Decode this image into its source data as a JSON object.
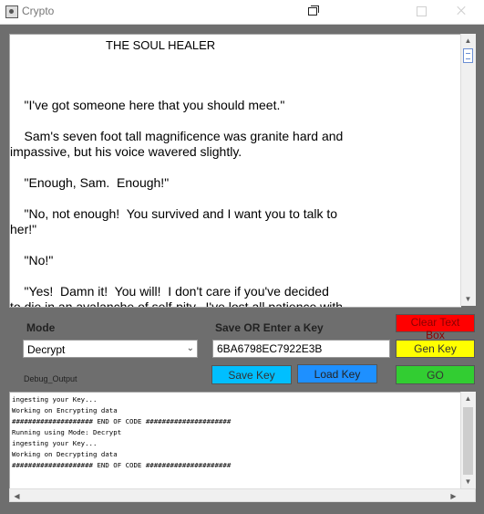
{
  "window": {
    "title": "Crypto",
    "app_icon": "app-icon",
    "controls": [
      "restore-icon",
      "maximize-icon",
      "close-icon"
    ]
  },
  "document": {
    "title": "THE SOUL HEALER",
    "paragraphs": [
      "    \"I've got someone here that you should meet.\"",
      "    Sam's seven foot tall magnificence was granite hard and",
      "impassive, but his voice wavered slightly.",
      "    \"Enough, Sam.  Enough!\"",
      "    \"No, not enough!  You survived and I want you to talk to",
      "her!\"",
      "    \"No!\"",
      "    \"Yes!  Damn it!  You will!  I don't care if you've decided",
      "to die in an avalanche of self-pity.  I've lost all patience with"
    ]
  },
  "mode": {
    "label": "Mode",
    "selected": "Decrypt",
    "icon": "chevron-down-icon"
  },
  "key": {
    "label": "Save OR Enter a Key",
    "value": "6BA6798EC7922E3B"
  },
  "buttons": {
    "clear": "Clear Text Box",
    "gen_key": "Gen Key",
    "save_key": "Save Key",
    "load_key": "Load Key",
    "go": "GO"
  },
  "debug": {
    "label": "Debug_Output",
    "lines": [
      "ingesting your Key...",
      "Working on Encrypting data",
      "#################### END OF CODE #####################",
      "Running using Mode: Decrypt",
      "ingesting your Key...",
      "Working on Decrypting data",
      "#################### END OF CODE #####################"
    ]
  },
  "colors": {
    "clear": "#ff0000",
    "gen_key": "#ffff00",
    "save_key": "#00bfff",
    "load_key": "#1e90ff",
    "go": "#32cd32"
  }
}
